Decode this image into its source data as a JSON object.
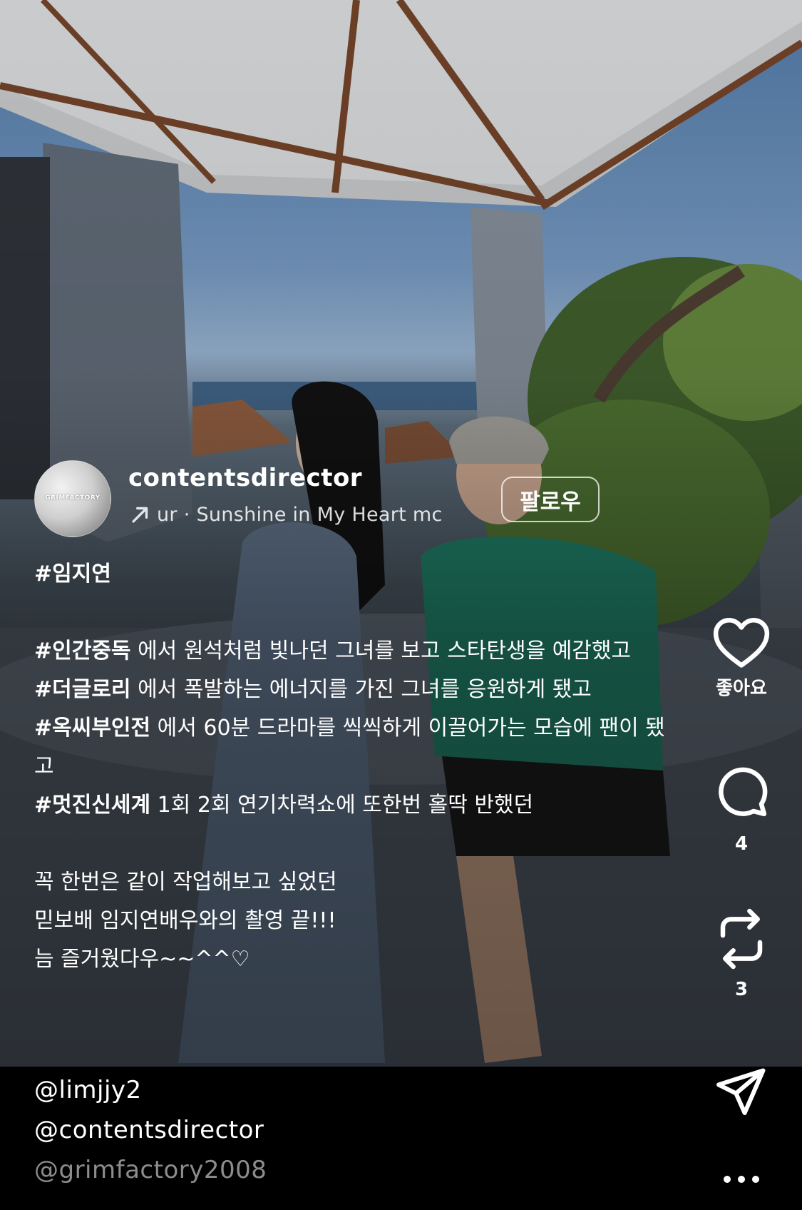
{
  "account": {
    "avatar_text": "GRIMFACTORY",
    "username": "contentsdirector",
    "music": "ur · Sunshine in My Heart     mc",
    "follow_label": "팔로우"
  },
  "caption": {
    "hashtag_name": "#임지연",
    "lines": [
      {
        "tag": "#인간중독",
        "text": " 에서 원석처럼 빛나던 그녀를 보고 스타탄생을 예감했고"
      },
      {
        "tag": "#더글로리",
        "text": " 에서 폭발하는 에너지를 가진 그녀를 응원하게 됐고"
      },
      {
        "tag": "#옥씨부인전",
        "text": " 에서 60분 드라마를 씩씩하게 이끌어가는 모습에 팬이 됐고"
      },
      {
        "tag": "#멋진신세계",
        "text": " 1회 2회 연기차력쇼에 또한번 홀딱 반했던"
      }
    ],
    "closing": [
      "꼭 한번은 같이 작업해보고 싶었던",
      "믿보배 임지연배우와의 촬영 끝!!!",
      "늠 즐거웠다우~~^^♡"
    ],
    "mentions": [
      "@limjjy2",
      "@contentsdirector",
      "@grimfactory2008"
    ]
  },
  "actions": {
    "like_label": "좋아요",
    "comment_count": "4",
    "repost_count": "3"
  },
  "icons": {
    "like": "heart-icon",
    "comment": "comment-icon",
    "repost": "repost-icon",
    "share": "send-icon",
    "more": "more-icon",
    "music": "arrow-up-right-icon"
  }
}
